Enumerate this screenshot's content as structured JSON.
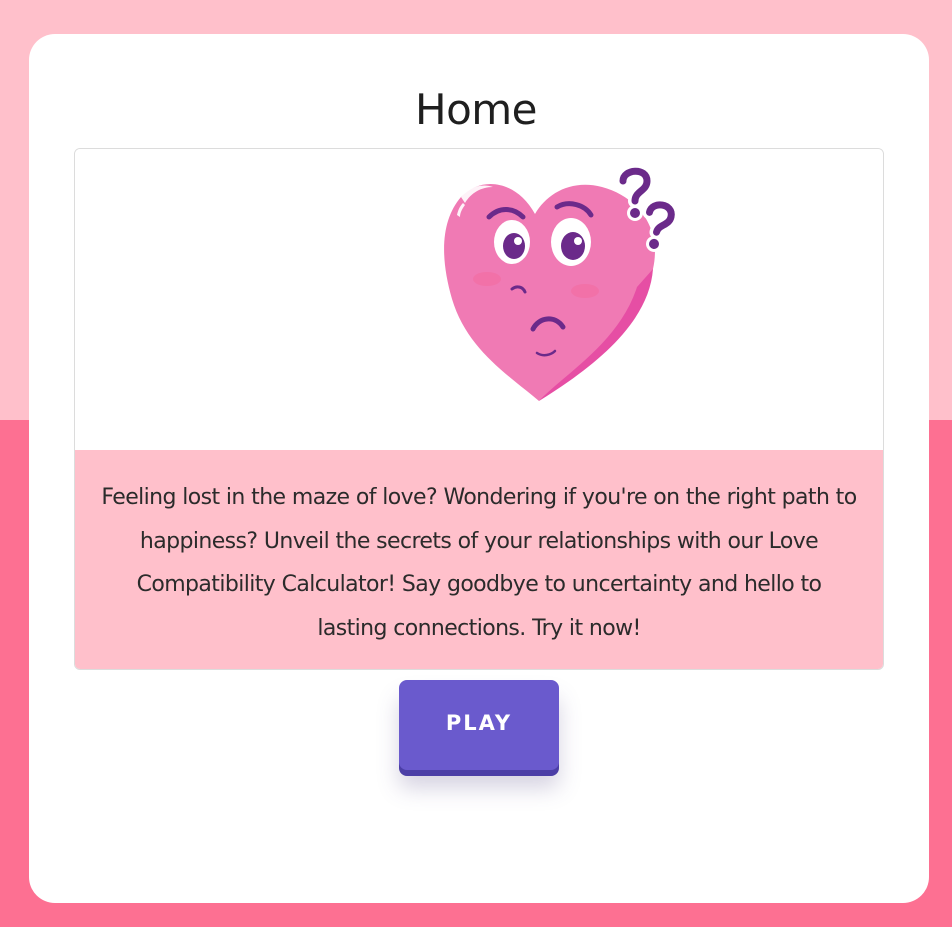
{
  "colors": {
    "background_top": "#ffc0cb",
    "background_bottom": "#fd7092",
    "panel": "#ffffff",
    "card_body": "#ffc0cb",
    "button": "#6a5acd",
    "heart": "#f07ab4",
    "accent_purple": "#6b2a8a"
  },
  "page": {
    "title": "Home"
  },
  "card": {
    "image_icon": "confused-heart-icon",
    "text": "Feeling lost in the maze of love? Wondering if you're on the right path to happiness? Unveil the secrets of your relationships with our Love Compatibility Calculator! Say goodbye to uncertainty and hello to lasting connections. Try it now!"
  },
  "actions": {
    "play_label": "PLAY"
  }
}
